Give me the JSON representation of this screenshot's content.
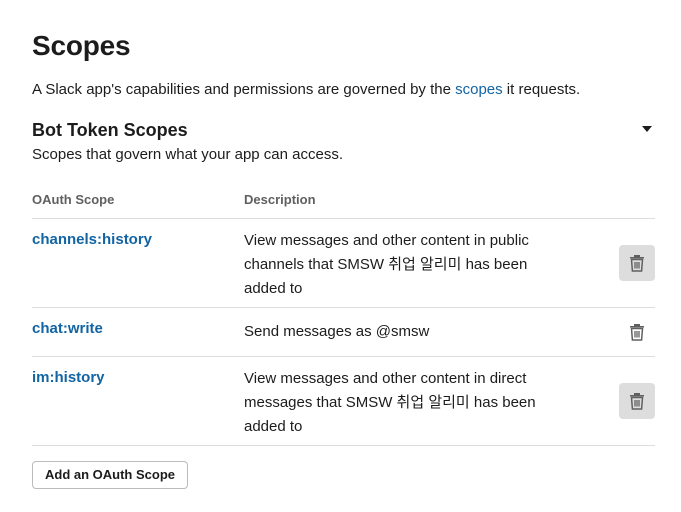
{
  "page": {
    "title": "Scopes",
    "intro_prefix": "A Slack app's capabilities and permissions are governed by the ",
    "intro_link": "scopes",
    "intro_suffix": " it requests."
  },
  "section": {
    "title": "Bot Token Scopes",
    "subtitle": "Scopes that govern what your app can access.",
    "caret_icon": "caret-down-icon"
  },
  "table": {
    "headers": {
      "scope": "OAuth Scope",
      "description": "Description"
    },
    "rows": [
      {
        "scope": "channels:history",
        "description": "View messages and other content in public channels that SMSW 취업 알리미 has been added to",
        "icon": "trash-icon",
        "highlighted": true
      },
      {
        "scope": "chat:write",
        "description": "Send messages as @smsw",
        "icon": "trash-icon",
        "highlighted": false
      },
      {
        "scope": "im:history",
        "description": "View messages and other content in direct messages that SMSW 취업 알리미 has been added to",
        "icon": "trash-icon",
        "highlighted": true
      }
    ]
  },
  "actions": {
    "add_scope_label": "Add an OAuth Scope"
  },
  "colors": {
    "link": "#1264a3",
    "text": "#1d1c1d",
    "muted": "#616061",
    "divider": "#dddddd",
    "trash_bg": "#dddddd"
  }
}
